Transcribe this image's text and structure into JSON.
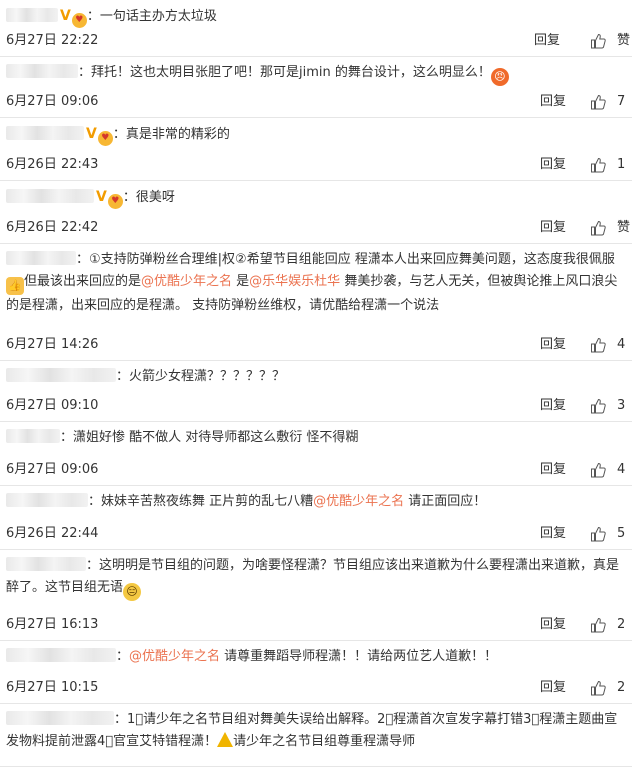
{
  "actions": {
    "reply_label": "回复",
    "like_label": "赞"
  },
  "comments": [
    {
      "segments": [
        {
          "type": "text",
          "value": "：一句话主办方太垃圾"
        }
      ],
      "time": "6月27日 22:22",
      "like": "赞"
    },
    {
      "segments": [
        {
          "type": "text",
          "value": "：拜托！这也太明目张胆了吧！那可是jimin 的舞台设计，这么明显么！"
        },
        {
          "type": "emoji",
          "name": "angry-emoji"
        }
      ],
      "time": "6月27日 09:06",
      "like": "7"
    },
    {
      "segments": [
        {
          "type": "text",
          "value": "：真是非常的精彩的"
        }
      ],
      "time": "6月26日 22:43",
      "like": "1"
    },
    {
      "segments": [
        {
          "type": "text",
          "value": "：很美呀"
        }
      ],
      "time": "6月26日 22:42",
      "like": "赞"
    },
    {
      "segments": [
        {
          "type": "text",
          "value": "：①支持防弹粉丝合理维|权②希望节目组能回应 程潇本人出来回应舞美问题，这态度我很佩服"
        },
        {
          "type": "emoji",
          "name": "thumbs-up-emoji"
        },
        {
          "type": "text",
          "value": "但最该出来回应的是"
        },
        {
          "type": "mention",
          "value": "@优酷少年之名"
        },
        {
          "type": "text",
          "value": " 是"
        },
        {
          "type": "mention",
          "value": "@乐华娱乐杜华"
        },
        {
          "type": "text",
          "value": "  舞美抄袭，与艺人无关，但被舆论推上风口浪尖的是程潇，出来回应的是程潇。 支持防弹粉丝维权，请优酷给程潇一个说法"
        }
      ],
      "time": "6月27日 14:26",
      "like": "4"
    },
    {
      "segments": [
        {
          "type": "text",
          "value": "：火箭少女程潇？？？？？？"
        }
      ],
      "time": "6月27日 09:10",
      "like": "3"
    },
    {
      "segments": [
        {
          "type": "text",
          "value": "：潇姐好惨 酷不做人 对待导师都这么敷衍 怪不得糊"
        }
      ],
      "time": "6月27日 09:06",
      "like": "4"
    },
    {
      "segments": [
        {
          "type": "text",
          "value": "：妹妹辛苦熬夜练舞 正片剪的乱七八糟"
        },
        {
          "type": "mention",
          "value": "@优酷少年之名"
        },
        {
          "type": "text",
          "value": " 请正面回应！"
        }
      ],
      "time": "6月26日 22:44",
      "like": "5"
    },
    {
      "segments": [
        {
          "type": "text",
          "value": "：这明明是节目组的问题，为啥要怪程潇？节目组应该出来道歉为什么要程潇出来道歉，真是醉了。这节目组无语"
        },
        {
          "type": "emoji",
          "name": "speechless-emoji"
        }
      ],
      "time": "6月27日 16:13",
      "like": "2"
    },
    {
      "segments": [
        {
          "type": "text",
          "value": "："
        },
        {
          "type": "mention",
          "value": "@优酷少年之名"
        },
        {
          "type": "text",
          "value": " 请尊重舞蹈导师程潇！！请给两位艺人道歉！！"
        }
      ],
      "time": "6月27日 10:15",
      "like": "2"
    },
    {
      "segments": [
        {
          "type": "text",
          "value": "：1⃣请少年之名节目组对舞美失误给出解释。2⃣程潇首次宣发字幕打错3⃣程潇主题曲宣发物料提前泄露4⃣官宣艾特错程潇！"
        },
        {
          "type": "emoji",
          "name": "warning-emoji"
        },
        {
          "type": "text",
          "value": "请少年之名节目组尊重程潇导师"
        }
      ],
      "time": "",
      "like": ""
    }
  ]
}
